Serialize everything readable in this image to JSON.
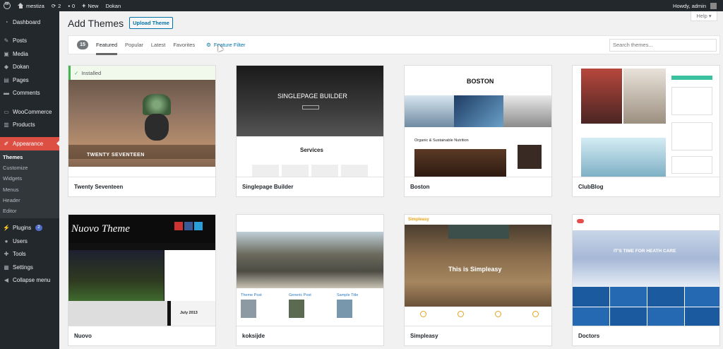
{
  "adminbar": {
    "site_name": "mestiza",
    "updates_count": "2",
    "comments_count": "0",
    "new_label": "New",
    "plugin_label": "Dokan",
    "greeting": "Howdy, admin"
  },
  "sidebar": {
    "items": [
      {
        "label": "Dashboard",
        "icon": "dashboard-icon"
      },
      {
        "label": "Posts",
        "icon": "pin-icon"
      },
      {
        "label": "Media",
        "icon": "media-icon"
      },
      {
        "label": "Dokan",
        "icon": "dokan-icon"
      },
      {
        "label": "Pages",
        "icon": "page-icon"
      },
      {
        "label": "Comments",
        "icon": "comment-icon"
      },
      {
        "label": "WooCommerce",
        "icon": "woocommerce-icon"
      },
      {
        "label": "Products",
        "icon": "products-icon"
      },
      {
        "label": "Appearance",
        "icon": "brush-icon"
      },
      {
        "label": "Plugins",
        "icon": "plugin-icon",
        "badge": "2"
      },
      {
        "label": "Users",
        "icon": "users-icon"
      },
      {
        "label": "Tools",
        "icon": "tools-icon"
      },
      {
        "label": "Settings",
        "icon": "settings-icon"
      },
      {
        "label": "Collapse menu",
        "icon": "collapse-icon"
      }
    ],
    "appearance_submenu": [
      "Themes",
      "Customize",
      "Widgets",
      "Menus",
      "Header",
      "Editor"
    ]
  },
  "header": {
    "title": "Add Themes",
    "upload_label": "Upload Theme",
    "help_label": "Help"
  },
  "filter": {
    "count": "15",
    "tabs": [
      "Featured",
      "Popular",
      "Latest",
      "Favorites"
    ],
    "active_tab": "Featured",
    "feature_filter_label": "Feature Filter",
    "search_placeholder": "Search themes..."
  },
  "themes": [
    {
      "name": "Twenty Seventeen",
      "installed_label": "Installed",
      "shot_title": "TWENTY SEVENTEEN"
    },
    {
      "name": "Singlepage Builder",
      "shot_title": "SINGLEPAGE BUILDER",
      "shot_section": "Services"
    },
    {
      "name": "Boston",
      "shot_title": "BOSTON",
      "shot_post": "Organic & Sustainable Nutrition"
    },
    {
      "name": "ClubBlog"
    },
    {
      "name": "Nuovo",
      "shot_title": "Nuovo Theme",
      "shot_month": "July 2013"
    },
    {
      "name": "koksijde",
      "shot_cols": [
        "Theme Post",
        "Generic Post",
        "Sample Title"
      ]
    },
    {
      "name": "Simpleasy",
      "shot_logo": "Simpleasy",
      "shot_title": "This is Simpleasy"
    },
    {
      "name": "Doctors",
      "shot_title": "IT'S TIME FOR HEATH CARE"
    }
  ],
  "colors": {
    "admin_dark": "#23282d",
    "appearance_active": "#dd4f43",
    "link_blue": "#0073aa",
    "installed_green": "#46b450"
  }
}
